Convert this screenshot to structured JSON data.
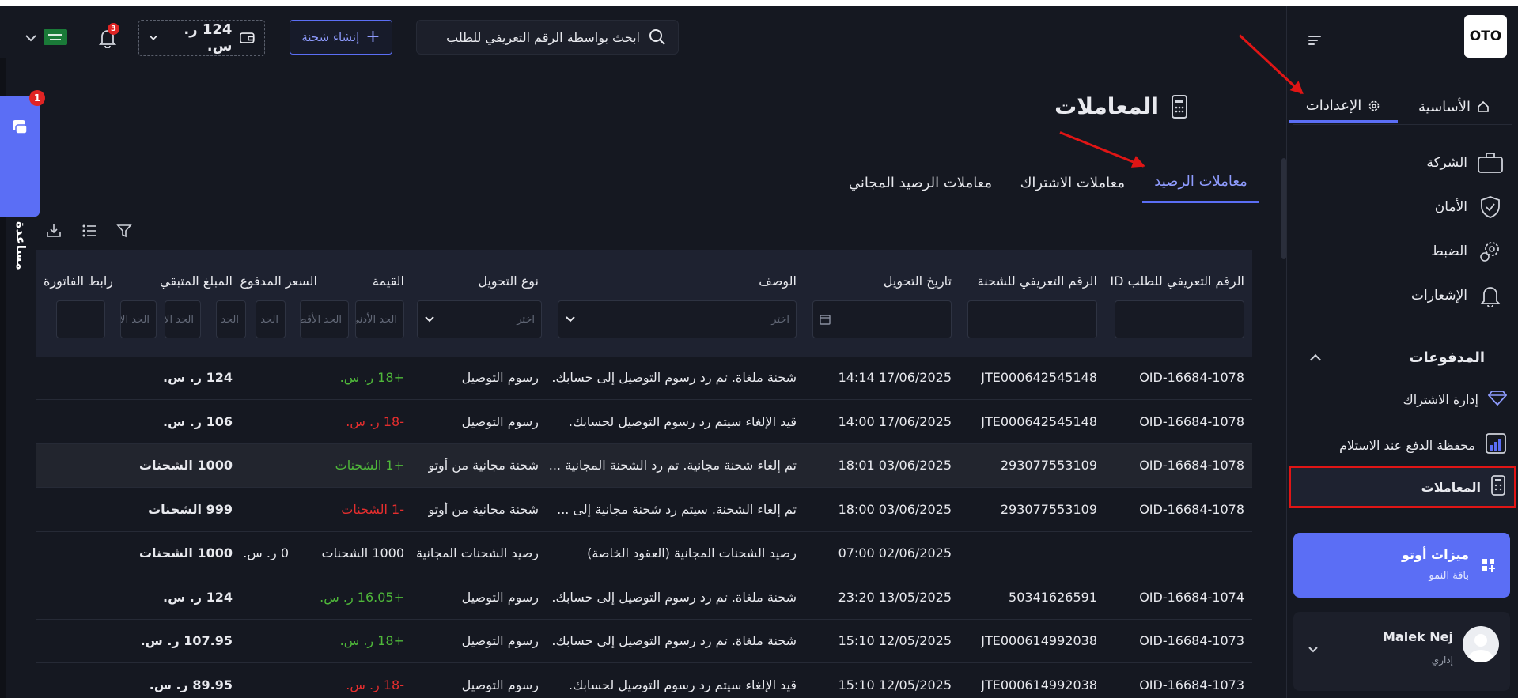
{
  "sidebar": {
    "logo": "OTO",
    "tabs": [
      {
        "label": "الأساسية",
        "icon": "home-icon",
        "active": false
      },
      {
        "label": "الإعدادات",
        "icon": "gear-icon",
        "active": true
      }
    ],
    "items": [
      {
        "label": "الشركة",
        "icon": "briefcase-icon"
      },
      {
        "label": "الأمان",
        "icon": "shield-icon"
      },
      {
        "label": "الضبط",
        "icon": "gears-icon"
      },
      {
        "label": "الإشعارات",
        "icon": "bell-icon"
      }
    ],
    "payments": {
      "title": "المدفوعات",
      "items": [
        {
          "label": "إدارة الاشتراك",
          "icon": "diamond-icon"
        },
        {
          "label": "محفظة الدفع عند الاستلام",
          "icon": "wallet-chart-icon"
        },
        {
          "label": "المعاملات",
          "icon": "receipt-icon",
          "selected": true
        }
      ]
    },
    "promo": {
      "title": "ميزات أوتو",
      "subtitle": "باقة النمو"
    },
    "user": {
      "name": "Malek Nej",
      "role": "إداري"
    }
  },
  "topbar": {
    "search_placeholder": "ابحث بواسطة الرقم التعريفي للطلب",
    "create_button": "إنشاء شحنة",
    "wallet_balance": "124 ر. س.",
    "notification_count": "3"
  },
  "help": {
    "label": "مساعدة",
    "badge": "1"
  },
  "page": {
    "title": "المعاملات",
    "tabs": [
      {
        "label": "معاملات الرصيد",
        "active": true
      },
      {
        "label": "معاملات الاشتراك",
        "active": false
      },
      {
        "label": "معاملات الرصيد المجاني",
        "active": false
      }
    ]
  },
  "table": {
    "headers": {
      "order_id": "الرقم التعريفي للطلب ID",
      "shipment_id": "الرقم التعريفي للشحنة",
      "date": "تاريخ التحويل",
      "desc": "الوصف",
      "type": "نوع التحويل",
      "value": "القيمة",
      "paid": "السعر المدفوع",
      "remaining": "المبلغ المتبقي",
      "invoice": "رابط الفاتورة"
    },
    "filters": {
      "select_placeholder": "اختر",
      "min_placeholder": "الحد الأدنى",
      "max_placeholder": "الحد الأقصى"
    },
    "rows": [
      {
        "order_id": "OID-16684-1078",
        "shipment_id": "JTE000642545148",
        "date": "17/06/2025 14:14",
        "desc": "شحنة ملغاة. تم رد رسوم التوصيل إلى حسابك.",
        "type": "رسوم التوصيل",
        "value": "+18 ر. س.",
        "value_sign": "pos",
        "paid": "",
        "remaining": "124 ر. س."
      },
      {
        "order_id": "OID-16684-1078",
        "shipment_id": "JTE000642545148",
        "date": "17/06/2025 14:00",
        "desc": "قيد الإلغاء سيتم رد رسوم التوصيل لحسابك.",
        "type": "رسوم التوصيل",
        "value": "-18 ر. س.",
        "value_sign": "neg",
        "paid": "",
        "remaining": "106 ر. س."
      },
      {
        "order_id": "OID-16684-1078",
        "shipment_id": "293077553109",
        "date": "03/06/2025 18:01",
        "desc": "تم إلغاء شحنة مجانية. تم رد الشحنة المجانية ...",
        "type": "شحنة مجانية من أوتو",
        "value": "+1 الشحنات",
        "value_sign": "pos",
        "paid": "",
        "remaining": "1000 الشحنات",
        "highlight": true
      },
      {
        "order_id": "OID-16684-1078",
        "shipment_id": "293077553109",
        "date": "03/06/2025 18:00",
        "desc": "تم إلغاء الشحنة. سيتم رد شحنة مجانية إلى ...",
        "type": "شحنة مجانية من أوتو",
        "value": "-1 الشحنات",
        "value_sign": "neg",
        "paid": "",
        "remaining": "999 الشحنات"
      },
      {
        "order_id": "",
        "shipment_id": "",
        "date": "02/06/2025 07:00",
        "desc": "رصيد الشحنات المجانية (العقود الخاصة)",
        "type": "رصيد الشحنات المجانية",
        "value": "1000 الشحنات",
        "value_sign": "plain",
        "paid": "0 ر. س.",
        "remaining": "1000 الشحنات"
      },
      {
        "order_id": "OID-16684-1074",
        "shipment_id": "50341626591",
        "date": "13/05/2025 23:20",
        "desc": "شحنة ملغاة. تم رد رسوم التوصيل إلى حسابك.",
        "type": "رسوم التوصيل",
        "value": "+16.05 ر. س.",
        "value_sign": "pos",
        "paid": "",
        "remaining": "124 ر. س."
      },
      {
        "order_id": "OID-16684-1073",
        "shipment_id": "JTE000614992038",
        "date": "12/05/2025 15:10",
        "desc": "شحنة ملغاة. تم رد رسوم التوصيل إلى حسابك.",
        "type": "رسوم التوصيل",
        "value": "+18 ر. س.",
        "value_sign": "pos",
        "paid": "",
        "remaining": "107.95 ر. س."
      },
      {
        "order_id": "OID-16684-1073",
        "shipment_id": "JTE000614992038",
        "date": "12/05/2025 15:10",
        "desc": "قيد الإلغاء سيتم رد رسوم التوصيل لحسابك.",
        "type": "رسوم التوصيل",
        "value": "-18 ر. س.",
        "value_sign": "neg",
        "paid": "",
        "remaining": "89.95 ر. س."
      }
    ]
  }
}
